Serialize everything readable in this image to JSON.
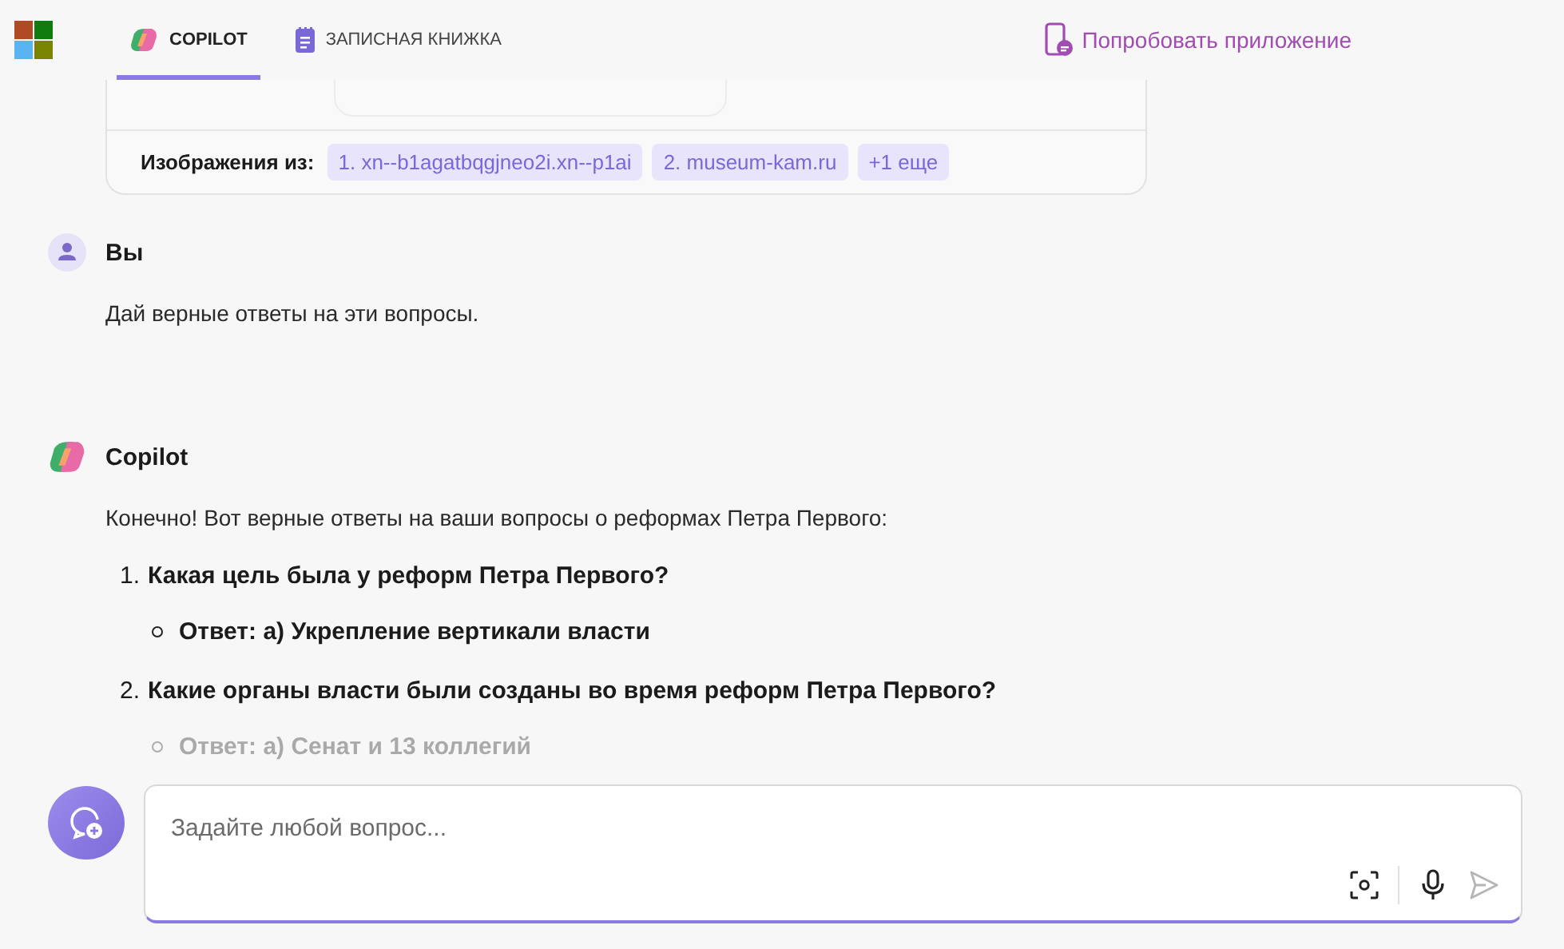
{
  "header": {
    "tabs": [
      {
        "label": "COPILOT",
        "selected": true,
        "kind": "copilot"
      },
      {
        "label": "ЗАПИСНАЯ КНИЖКА",
        "selected": false,
        "kind": "notebook"
      }
    ],
    "app_link": "Попробовать приложение"
  },
  "sources": {
    "label": "Изображения из:",
    "chips": [
      "1. xn--b1agatbqgjneo2i.xn--p1ai",
      "2. museum-kam.ru",
      "+1 еще"
    ]
  },
  "messages": [
    {
      "kind": "user",
      "author": "Вы",
      "text": "Дай верные ответы на эти вопросы."
    },
    {
      "kind": "assistant",
      "author": "Copilot",
      "intro": "Конечно! Вот верные ответы на ваши вопросы о реформах Петра Первого:",
      "items": [
        {
          "number": "1.",
          "question": "Какая цель была у реформ Петра Первого?",
          "answers": [
            {
              "text": "Ответ: а) Укрепление вертикали власти",
              "faded": false
            }
          ]
        },
        {
          "number": "2.",
          "question": "Какие органы власти были созданы во время реформ Петра Первого?",
          "answers": [
            {
              "text": "Ответ: а) Сенат и 13 коллегий",
              "faded": true
            }
          ]
        }
      ]
    }
  ],
  "composer": {
    "placeholder": "Задайте любой вопрос..."
  }
}
